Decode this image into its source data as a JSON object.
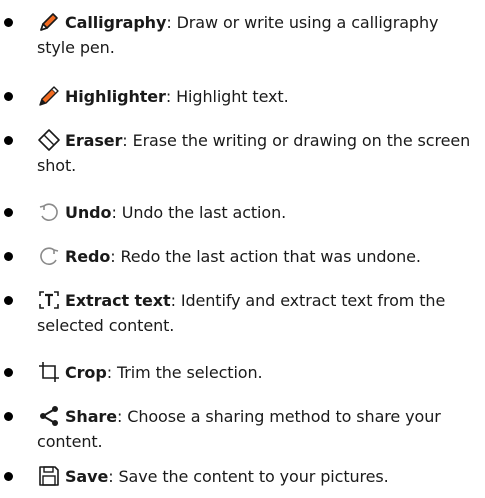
{
  "items": [
    {
      "icon": "calligraphy-pen-icon",
      "term": "Calligraphy",
      "desc": ": Draw or write using a calligraphy style pen."
    },
    {
      "icon": "highlighter-icon",
      "term": "Highlighter",
      "desc": ": Highlight text."
    },
    {
      "icon": "eraser-icon",
      "term": "Eraser",
      "desc": ": Erase the writing or drawing on the screen shot."
    },
    {
      "icon": "undo-icon",
      "term": "Undo",
      "desc": ": Undo the last action."
    },
    {
      "icon": "redo-icon",
      "term": "Redo",
      "desc": ": Redo the last action that was undone."
    },
    {
      "icon": "extract-text-icon",
      "term": "Extract text",
      "desc": ": Identify and extract text from the selected content."
    },
    {
      "icon": "crop-icon",
      "term": "Crop",
      "desc": ": Trim the selection."
    },
    {
      "icon": "share-icon",
      "term": "Share",
      "desc": ": Choose a sharing method to share your content."
    },
    {
      "icon": "save-icon",
      "term": "Save",
      "desc": ": Save the content to your pictures."
    }
  ],
  "colors": {
    "accent": "#f26b21",
    "text": "#1a1a1a",
    "icon_gray": "#8a8a8a"
  }
}
